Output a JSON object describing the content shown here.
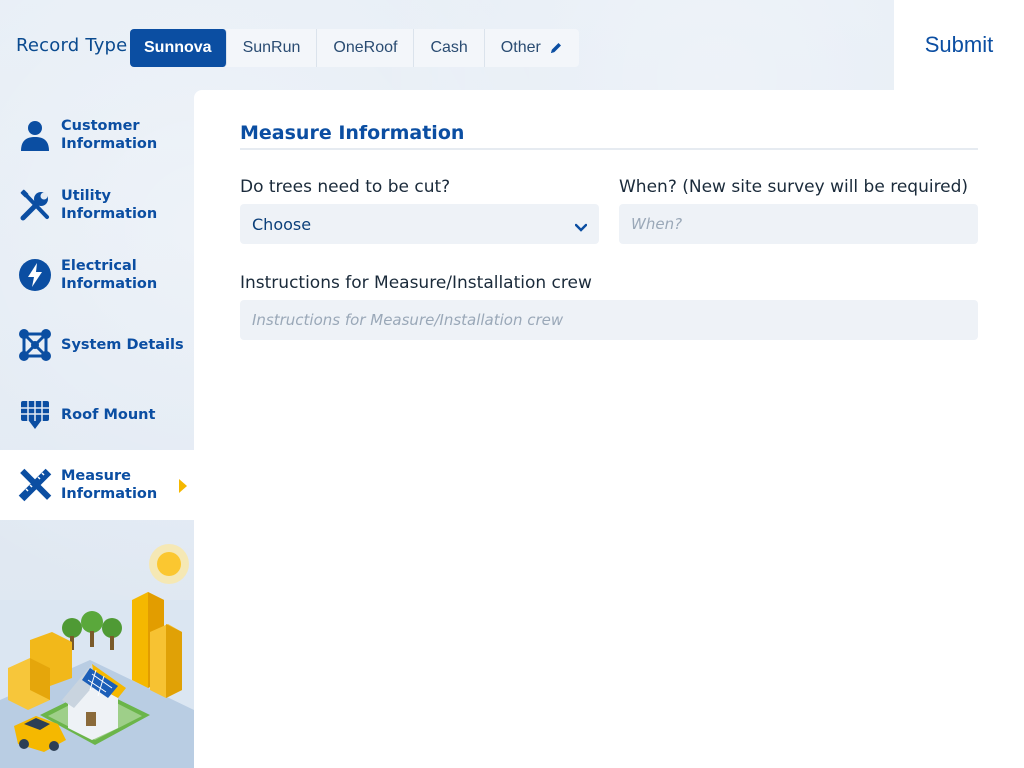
{
  "header": {
    "record_type_label": "Record Type",
    "segments": [
      {
        "label": "Sunnova",
        "active": true
      },
      {
        "label": "SunRun",
        "active": false
      },
      {
        "label": "OneRoof",
        "active": false
      },
      {
        "label": "Cash",
        "active": false
      },
      {
        "label": "Other",
        "active": false,
        "icon": "pencil-icon"
      }
    ],
    "submit_label": "Submit"
  },
  "sidebar": {
    "items": [
      {
        "label": "Customer\nInformation",
        "icon": "person-icon",
        "active": false
      },
      {
        "label": "Utility\nInformation",
        "icon": "tools-icon",
        "active": false
      },
      {
        "label": "Electrical\nInformation",
        "icon": "lightning-icon",
        "active": false
      },
      {
        "label": "System Details",
        "icon": "network-icon",
        "active": false
      },
      {
        "label": "Roof Mount",
        "icon": "solar-panel-icon",
        "active": false
      },
      {
        "label": "Measure\nInformation",
        "icon": "ruler-pencil-icon",
        "active": true
      }
    ]
  },
  "main": {
    "section_title": "Measure Information",
    "trees_label": "Do trees need to be cut?",
    "trees_value": "Choose",
    "when_label": "When? (New site survey will be required)",
    "when_placeholder": "When?",
    "instructions_label": "Instructions for Measure/Installation crew",
    "instructions_placeholder": "Instructions for Measure/Installation crew"
  },
  "colors": {
    "accent": "#0b4ea2",
    "active_arrow": "#f5b800",
    "background": "#e4ebf4",
    "field_bg": "#eef2f7"
  }
}
